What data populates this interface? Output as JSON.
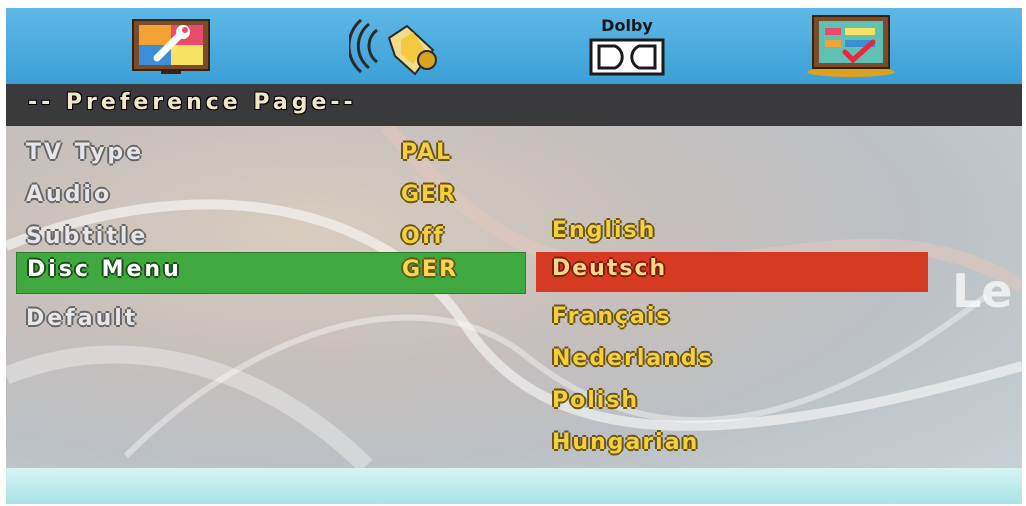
{
  "tabs": [
    {
      "name": "general-setup",
      "icon": "tv-wrench-icon",
      "label": ""
    },
    {
      "name": "audio-setup",
      "icon": "speaker-sound-icon",
      "label": ""
    },
    {
      "name": "dolby-setup",
      "icon": "dolby-digital-icon",
      "label": "Dolby"
    },
    {
      "name": "preference-setup",
      "icon": "checklist-icon",
      "label": ""
    }
  ],
  "page_title": "-- Preference Page--",
  "menu": [
    {
      "label": "TV Type",
      "value": "PAL"
    },
    {
      "label": "Audio",
      "value": "GER"
    },
    {
      "label": "Subtitle",
      "value": "Off"
    },
    {
      "label": "Disc Menu",
      "value": "GER",
      "selected": true
    },
    {
      "label": "Default",
      "value": ""
    }
  ],
  "options": [
    "English",
    "Deutsch",
    "Français",
    "Nederlands",
    "Polish",
    "Hungarian"
  ],
  "highlighted_option": "Deutsch",
  "logo_fragment": "Le",
  "colors": {
    "topbar": "#3b9fd6",
    "titlebar": "#3a3a3c",
    "selected_row": "#3fa83f",
    "highlighted_option": "#d63a22",
    "value_text": "#f2d040"
  }
}
